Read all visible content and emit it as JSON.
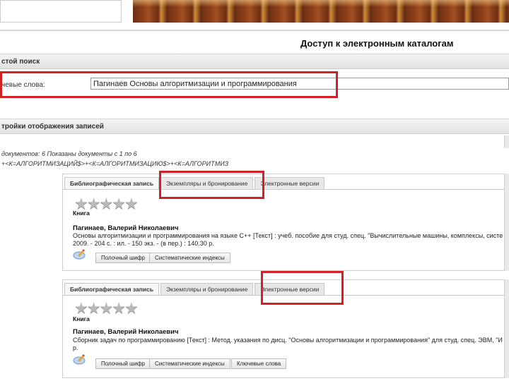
{
  "page": {
    "title": "Доступ к электронным каталогам"
  },
  "search": {
    "section_title": "стой поиск",
    "keywords_label": "чевые слова:",
    "keywords_value": "Пагинаев Основы алгоритмизации и программирования"
  },
  "display_settings": {
    "section_title": "тройки отображения записей"
  },
  "results": {
    "info": "документов: 6 Показаны документы с 1 по 6",
    "query": "+<К=АЛГОРИТМИЗАЦИЙ$>+<К=АЛГОРИТМИЗАЦИЮ$>+<К=АЛГОРИТМИЗ"
  },
  "colors": {
    "highlight": "#d32027",
    "tab_active": "#f7f7f7",
    "banner": "#8c3f1a"
  },
  "records": [
    {
      "tabs": [
        "Библиографическая запись",
        "Экземпляры и бронирование",
        "Электронные версии"
      ],
      "type": "Книга",
      "rating_of_5": 0,
      "author": "Пагинаев, Валерий Николаевич",
      "desc_line1": "Основы алгоритмизации и программирования на языке С++ [Текст] : учеб. пособие для студ. спец. \"Вычислительные машины, комплексы, систе",
      "desc_line2": "2009. - 204 с. : ил. - 150 экз. - (в пер.) : 140.30 р.",
      "buttons": [
        "Полочный шифр",
        "Систематические индексы"
      ]
    },
    {
      "tabs": [
        "Библиографическая запись",
        "Экземпляры и бронирование",
        "Электронные версии"
      ],
      "type": "Книга",
      "rating_of_5": 0,
      "author": "Пагинаев, Валерий Николаевич",
      "desc_line1": "Сборник задач по программированию [Текст] : Метод. указания по дисц. \"Основы алгоритмизации и программирования\" для студ. спец. ЭВМ, \"И",
      "desc_line2": "р.",
      "buttons": [
        "Полочный шифр",
        "Систематические индексы",
        "Ключевые слова"
      ]
    }
  ]
}
